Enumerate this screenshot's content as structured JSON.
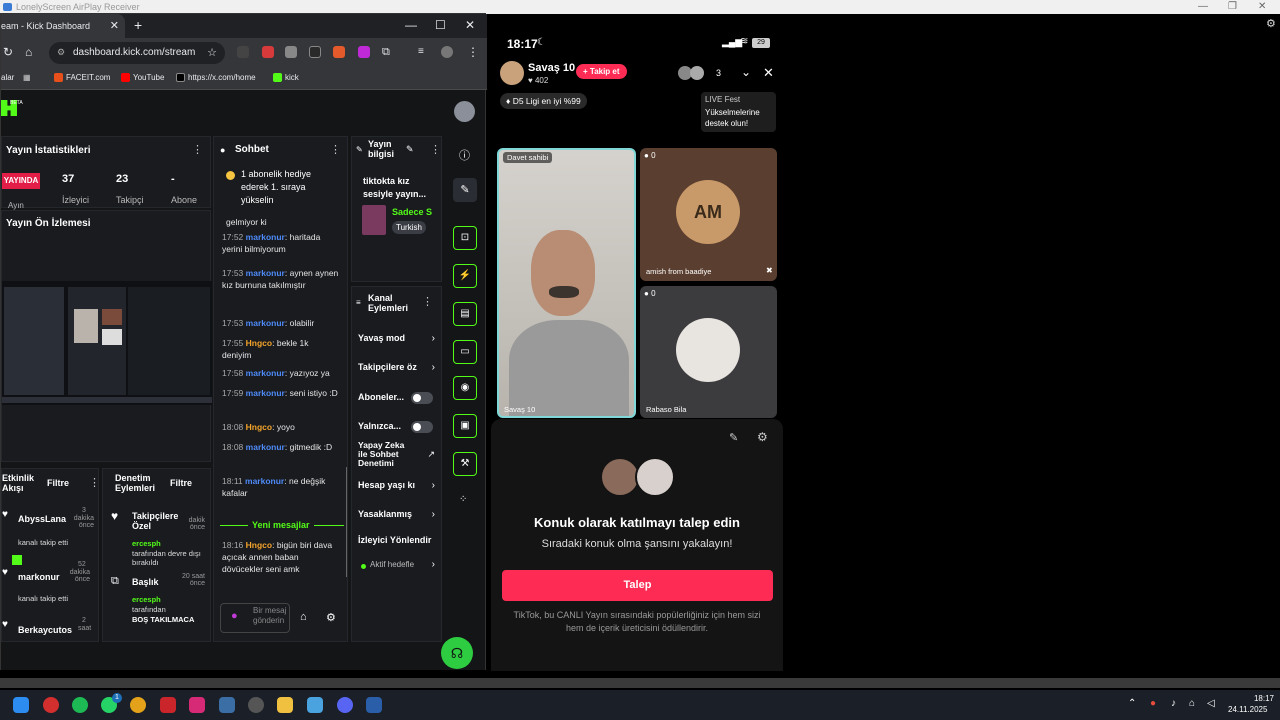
{
  "airplay": {
    "title": "LonelyScreen AirPlay Receiver"
  },
  "browser": {
    "tab_title": "eam - Kick Dashboard",
    "url": "dashboard.kick.com/stream",
    "bookmarks": [
      {
        "label": "alar"
      },
      {
        "label": "FACEIT.com"
      },
      {
        "label": "YouTube"
      },
      {
        "label": "https://x.com/home"
      },
      {
        "label": "kick"
      }
    ]
  },
  "kick": {
    "logo_beta": "BETA",
    "stats": {
      "title": "Yayın İstatistikleri",
      "status": "YAYINDA",
      "viewers_value": "37",
      "viewers_label": "İzleyici",
      "followers_value": "23",
      "followers_label": "Takipçi",
      "subs_value": "-",
      "subs_label": "Abone",
      "partial": "Ayın"
    },
    "preview_title": "Yayın Ön İzlemesi",
    "activity": {
      "title": "Etkinlik Akışı",
      "filter": "Filtre",
      "items": [
        {
          "name": "AbyssLana",
          "time": "3",
          "unit": "dakika önce",
          "desc": "kanalı takip etti"
        },
        {
          "name": "markonur",
          "time": "52",
          "unit": "dakika önce",
          "desc": "kanalı takip etti"
        },
        {
          "name": "Berkaycutos",
          "time": "2",
          "unit": "saat"
        }
      ]
    },
    "moderation": {
      "title": "Denetim Eylemleri",
      "filter": "Filtre",
      "items": [
        {
          "title": "Takipçilere Özel",
          "time": "dakik önce",
          "user": "ercesph",
          "desc": "tarafından devre dışı bırakıldı"
        },
        {
          "title": "Başlık",
          "time": "20 saat önce",
          "user": "ercesph",
          "desc": "tarafından",
          "strong": "BOŞ TAKILMACA"
        }
      ]
    },
    "chat": {
      "title": "Sohbet",
      "pinned": "1 abonelik hediye ederek 1. sıraya yükselin",
      "partial": "gelmiyor ki",
      "messages": [
        {
          "t": "17:52",
          "u": "markonur",
          "m": "haritada yerini bilmiyorum"
        },
        {
          "t": "17:53",
          "u": "markonur",
          "m": "aynen aynen kız burnuna takılmıştır"
        },
        {
          "t": "17:53",
          "u": "markonur",
          "m": "olabilir"
        },
        {
          "t": "17:55",
          "u": "Hngco",
          "m": "bekle 1k deniyim"
        },
        {
          "t": "17:58",
          "u": "markonur",
          "m": "yazıyoz ya"
        },
        {
          "t": "17:59",
          "u": "markonur",
          "m": "seni istiyo :D"
        },
        {
          "t": "18:08",
          "u": "Hngco",
          "m": "yoyo"
        },
        {
          "t": "18:08",
          "u": "markonur",
          "m": "gitmedik :D"
        },
        {
          "t": "18:11",
          "u": "markonur",
          "m": "ne değşik kafalar"
        }
      ],
      "new_messages": "Yeni mesajlar",
      "last": {
        "t": "18:16",
        "u": "Hngco",
        "m": "bigün biri dava açıcak annen baban dövücekler seni amk"
      },
      "input_placeholder": "Bir mesaj gönderin"
    },
    "info": {
      "title": "Yayın bilgisi",
      "stream_title": "tiktokta kız sesiyle yayın...",
      "category": "Sadece S",
      "language": "Turkish"
    },
    "channel": {
      "title": "Kanal Eylemleri",
      "items": [
        "Yavaş mod",
        "Takipçilere öz",
        "Aboneler...",
        "Yalnızca...",
        "Yapay Zeka ile Sohbet Denetimi",
        "Hesap yaşı kı",
        "Yasaklanmış",
        "İzleyici Yönlendir",
        "Aktif hedefle"
      ]
    }
  },
  "phone": {
    "time": "18:17",
    "battery": "29",
    "host_name": "Savaş 10",
    "host_likes": "402",
    "follow": "+ Takip et",
    "viewer_count": "3",
    "rank": "D5 Ligi en iyi %99",
    "live_fest": "LIVE Fest",
    "live_fest_sub": "Yükselmelerine destek olun!",
    "host_badge": "Davet sahibi",
    "host_label": "Savaş 10",
    "guest1": "amish from baadiye",
    "guest1_count": "0",
    "guest1_initials": "AM",
    "guest2": "Rabaso Bila",
    "guest2_count": "0",
    "sheet_title": "Konuk olarak katılmayı talep edin",
    "sheet_sub": "Sıradaki konuk olma şansını yakalayın!",
    "request": "Talep",
    "footnote": "TikTok, bu CANLI Yayın sırasındaki popülerliğiniz için hem sizi hem de içerik üreticisini ödüllendirir."
  },
  "taskbar": {
    "time": "18:17",
    "date": "24.11.2025",
    "badge": "1"
  }
}
